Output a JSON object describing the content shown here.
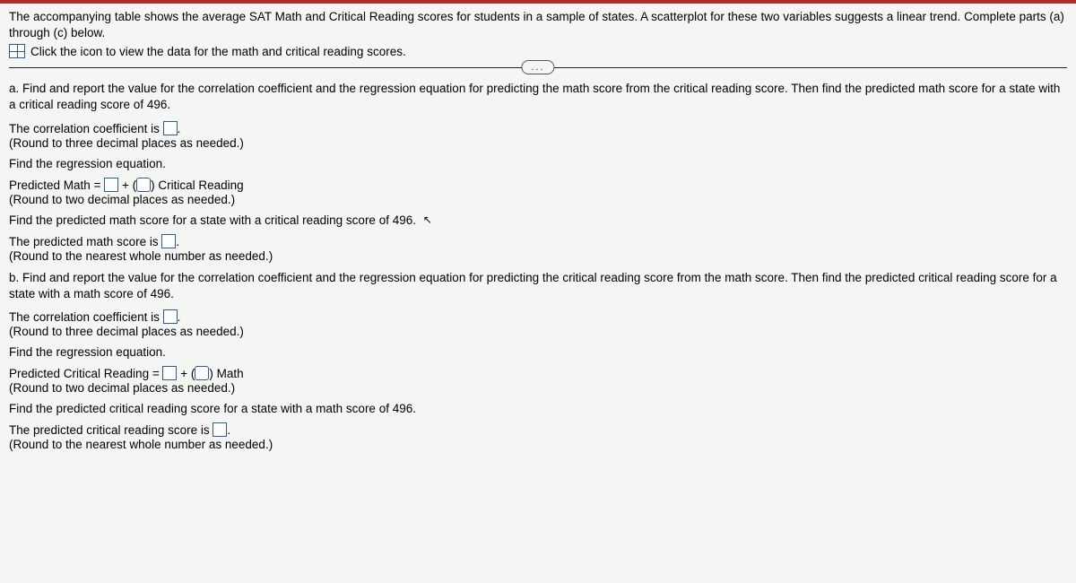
{
  "intro": "The accompanying table shows the average SAT Math and Critical Reading scores for students in a sample of states. A scatterplot for these two variables suggests a linear trend. Complete parts (a) through (c) below.",
  "data_link": "Click the icon to view the data for the math and critical reading scores.",
  "ellipsis": "...",
  "part_a": {
    "prompt": "a. Find and report the value for the correlation coefficient and the regression equation for predicting the math score from the critical reading score. Then find the predicted math score for a state with a critical reading score of 496.",
    "corr_label": "The correlation coefficient is",
    "corr_hint": "(Round to three decimal places as needed.)",
    "find_reg": "Find the regression equation.",
    "eq_lhs": "Predicted Math =",
    "eq_plus": "+",
    "eq_open": "(",
    "eq_close": ")",
    "eq_rhs": "Critical Reading",
    "eq_hint": "(Round to two decimal places as needed.)",
    "find_pred": "Find the predicted math score for a state with a critical reading score of 496.",
    "pred_label": "The predicted math score is",
    "pred_hint": "(Round to the nearest whole number as needed.)"
  },
  "part_b": {
    "prompt": "b. Find and report the value for the correlation coefficient and the regression equation for predicting the critical reading score from the math score. Then find the predicted critical reading score for a state with a math score of 496.",
    "corr_label": "The correlation coefficient is",
    "corr_hint": "(Round to three decimal places as needed.)",
    "find_reg": "Find the regression equation.",
    "eq_lhs": "Predicted Critical Reading =",
    "eq_plus": "+",
    "eq_open": "(",
    "eq_close": ")",
    "eq_rhs": "Math",
    "eq_hint": "(Round to two decimal places as needed.)",
    "find_pred": "Find the predicted critical reading score for a state with a math score of 496.",
    "pred_label": "The predicted critical reading score is",
    "pred_hint": "(Round to the nearest whole number as needed.)"
  },
  "period": "."
}
